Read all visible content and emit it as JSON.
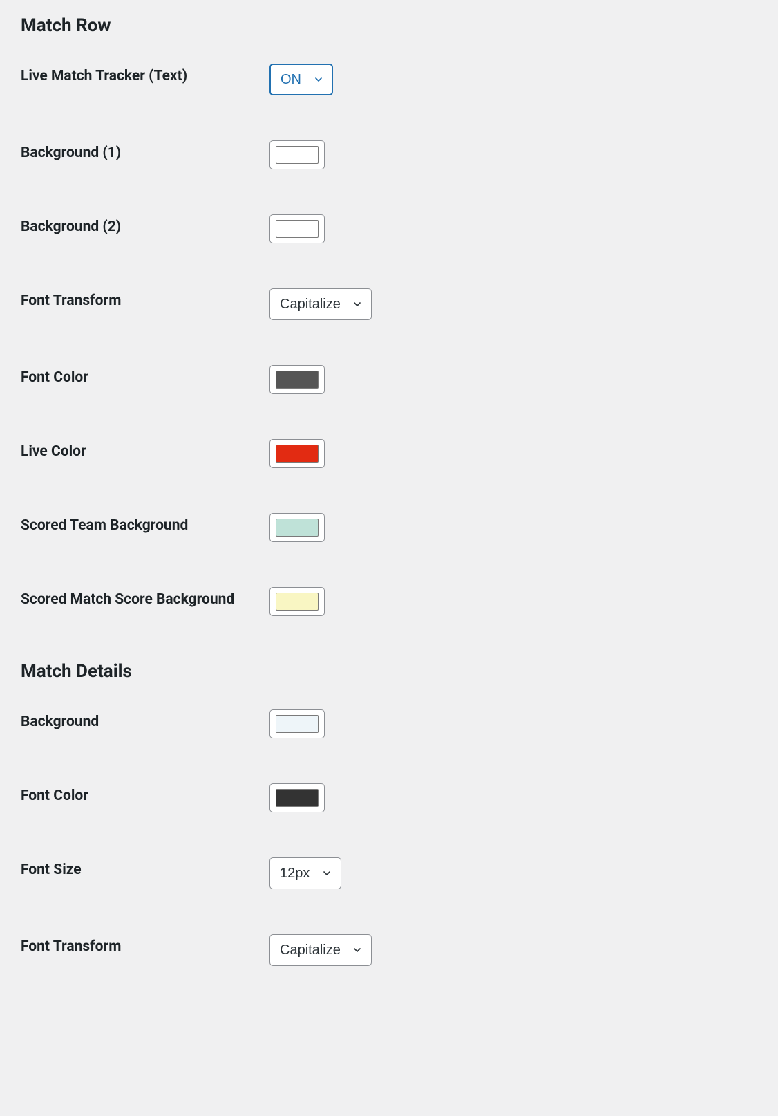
{
  "sections": {
    "match_row": {
      "heading": "Match Row",
      "fields": {
        "live_tracker": {
          "label": "Live Match Tracker (Text)",
          "value": "ON"
        },
        "bg1": {
          "label": "Background (1)",
          "color": "#ffffff"
        },
        "bg2": {
          "label": "Background (2)",
          "color": "#ffffff"
        },
        "font_transform": {
          "label": "Font Transform",
          "value": "Capitalize"
        },
        "font_color": {
          "label": "Font Color",
          "color": "#555555"
        },
        "live_color": {
          "label": "Live Color",
          "color": "#e22b12"
        },
        "scored_team_bg": {
          "label": "Scored Team Background",
          "color": "#bfe2d8"
        },
        "scored_score_bg": {
          "label": "Scored Match Score Background",
          "color": "#f9f6c3"
        }
      }
    },
    "match_details": {
      "heading": "Match Details",
      "fields": {
        "background": {
          "label": "Background",
          "color": "#eef5f9"
        },
        "font_color": {
          "label": "Font Color",
          "color": "#333333"
        },
        "font_size": {
          "label": "Font Size",
          "value": "12px"
        },
        "font_transform": {
          "label": "Font Transform",
          "value": "Capitalize"
        }
      }
    }
  }
}
